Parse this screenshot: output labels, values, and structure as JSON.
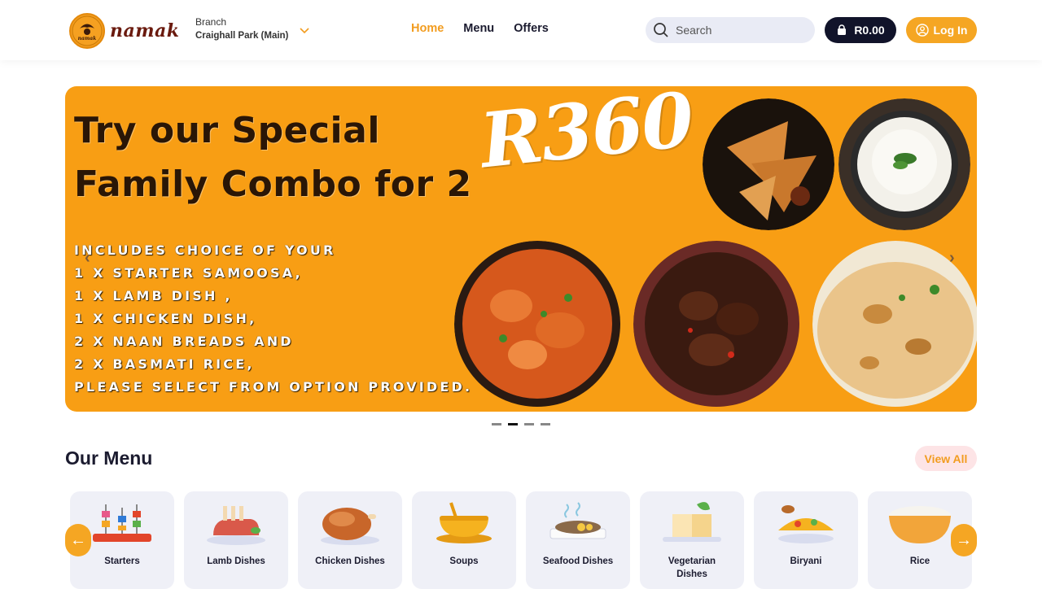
{
  "brand": {
    "name": "namak",
    "badge_text": "namak"
  },
  "branch": {
    "label": "Branch",
    "value": "Craighall Park (Main)"
  },
  "nav": [
    {
      "label": "Home",
      "active": true
    },
    {
      "label": "Menu",
      "active": false
    },
    {
      "label": "Offers",
      "active": false
    }
  ],
  "search": {
    "placeholder": "Search"
  },
  "cart": {
    "total": "R0.00"
  },
  "login": {
    "label": "Log In"
  },
  "banner": {
    "title_line1": "Try our Special",
    "title_line2": "Family Combo for 2",
    "price": "R360",
    "lines": [
      "INCLUDES CHOICE OF YOUR",
      "1 X STARTER SAMOOSA,",
      "1 X LAMB DISH ,",
      "1 X CHICKEN DISH,",
      "2 X NAAN BREADS AND",
      "2 X BASMATI RICE,",
      "PLEASE SELECT FROM OPTION PROVIDED."
    ],
    "prev_arrow": "‹",
    "next_arrow": "›"
  },
  "carousel": {
    "slide_count": 4,
    "active_index": 1
  },
  "menu_section": {
    "title": "Our Menu",
    "view_all": "View All",
    "prev": "←",
    "next": "→",
    "categories": [
      {
        "label": "Starters",
        "icon": "skewers-icon"
      },
      {
        "label": "Lamb Dishes",
        "icon": "lamb-rack-icon"
      },
      {
        "label": "Chicken Dishes",
        "icon": "roast-chicken-icon"
      },
      {
        "label": "Soups",
        "icon": "soup-bowl-icon"
      },
      {
        "label": "Seafood Dishes",
        "icon": "seafood-platter-icon"
      },
      {
        "label": "Vegetarian Dishes",
        "icon": "tofu-icon"
      },
      {
        "label": "Biryani",
        "icon": "biryani-icon"
      },
      {
        "label": "Rice",
        "icon": "rice-bowl-icon"
      }
    ]
  },
  "colors": {
    "accent": "#f5a623",
    "dark": "#11132a",
    "banner": "#f89e14"
  }
}
